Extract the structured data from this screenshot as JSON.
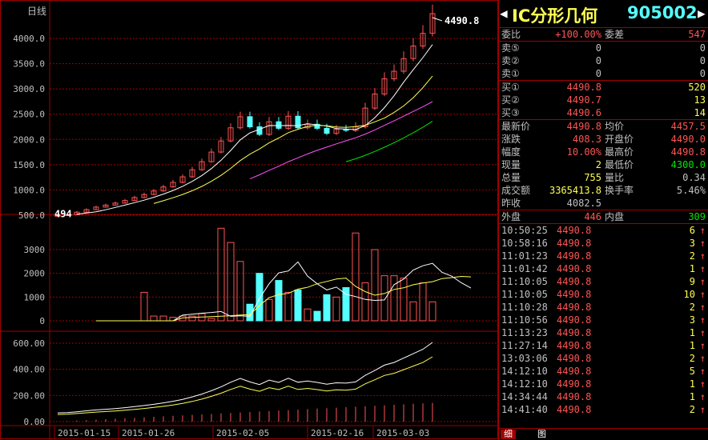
{
  "chart": {
    "period_label": "日线",
    "last_price_label": "4490.8",
    "first_price_label": "494",
    "price_axis": [
      "4000.0",
      "3500.0",
      "3000.0",
      "2500.0",
      "2000.0",
      "1500.0",
      "1000.0",
      "500.0"
    ],
    "volume_axis": [
      "3000",
      "2000",
      "1000",
      "0"
    ],
    "indicator_axis": [
      "600.00",
      "400.00",
      "200.00",
      "0.00"
    ],
    "date_axis": [
      "2015-01-15",
      "2015-01-26",
      "2015-02-05",
      "2015-02-16",
      "2015-03-03"
    ]
  },
  "quote": {
    "name": "IC分形几何",
    "code": "905002",
    "left_arrow": "◀",
    "right_arrow": "▶",
    "weibi_label": "委比",
    "weibi_value": "+100.00%",
    "weicha_label": "委差",
    "weicha_value": "547",
    "asks": [
      {
        "label": "卖⑤",
        "price": "0",
        "vol": "0"
      },
      {
        "label": "卖②",
        "price": "0",
        "vol": "0"
      },
      {
        "label": "卖①",
        "price": "0",
        "vol": "0"
      }
    ],
    "bids": [
      {
        "label": "买①",
        "price": "4490.8",
        "vol": "520"
      },
      {
        "label": "买②",
        "price": "4490.7",
        "vol": "13"
      },
      {
        "label": "买③",
        "price": "4490.6",
        "vol": "14"
      }
    ],
    "stats": [
      {
        "l1": "最新价",
        "v1": "4490.8",
        "l2": "均价",
        "v2": "4457.5"
      },
      {
        "l1": "涨跌",
        "v1": "408.3",
        "l2": "开盘价",
        "v2": "4490.0"
      },
      {
        "l1": "幅度",
        "v1": "10.00%",
        "l2": "最高价",
        "v2": "4490.8"
      },
      {
        "l1": "现量",
        "v1": "2",
        "l2": "最低价",
        "v2": "4300.0"
      },
      {
        "l1": "总量",
        "v1": "755",
        "l2": "量比",
        "v2": "0.34"
      },
      {
        "l1": "成交额",
        "v1": "3365413.8",
        "l2": "换手率",
        "v2": "5.46%"
      }
    ],
    "prev_close_label": "昨收",
    "prev_close_value": "4082.5",
    "outer_label": "外盘",
    "outer_value": "446",
    "inner_label": "内盘",
    "inner_value": "309",
    "trades": [
      {
        "time": "10:50:25",
        "price": "4490.8",
        "vol": "6"
      },
      {
        "time": "10:58:16",
        "price": "4490.8",
        "vol": "3"
      },
      {
        "time": "11:01:23",
        "price": "4490.8",
        "vol": "2"
      },
      {
        "time": "11:01:42",
        "price": "4490.8",
        "vol": "1"
      },
      {
        "time": "11:10:05",
        "price": "4490.8",
        "vol": "9"
      },
      {
        "time": "11:10:05",
        "price": "4490.8",
        "vol": "10"
      },
      {
        "time": "11:10:28",
        "price": "4490.8",
        "vol": "2"
      },
      {
        "time": "11:10:56",
        "price": "4490.8",
        "vol": "3"
      },
      {
        "time": "11:13:23",
        "price": "4490.8",
        "vol": "1"
      },
      {
        "time": "11:27:14",
        "price": "4490.8",
        "vol": "1"
      },
      {
        "time": "13:03:06",
        "price": "4490.8",
        "vol": "2"
      },
      {
        "time": "14:12:10",
        "price": "4490.8",
        "vol": "5"
      },
      {
        "time": "14:12:10",
        "price": "4490.8",
        "vol": "1"
      },
      {
        "time": "14:34:44",
        "price": "4490.8",
        "vol": "1"
      },
      {
        "time": "14:41:40",
        "price": "4490.8",
        "vol": "2"
      }
    ],
    "up_arrow": "↑",
    "tabs": [
      "细",
      "图"
    ]
  },
  "colors": {
    "up": "#ff5454",
    "down": "#54ffff",
    "grid": "#a00000",
    "ma1": "#ffffff",
    "ma2": "#ffff54",
    "ma3": "#ff54ff",
    "ma4": "#00e600"
  }
}
